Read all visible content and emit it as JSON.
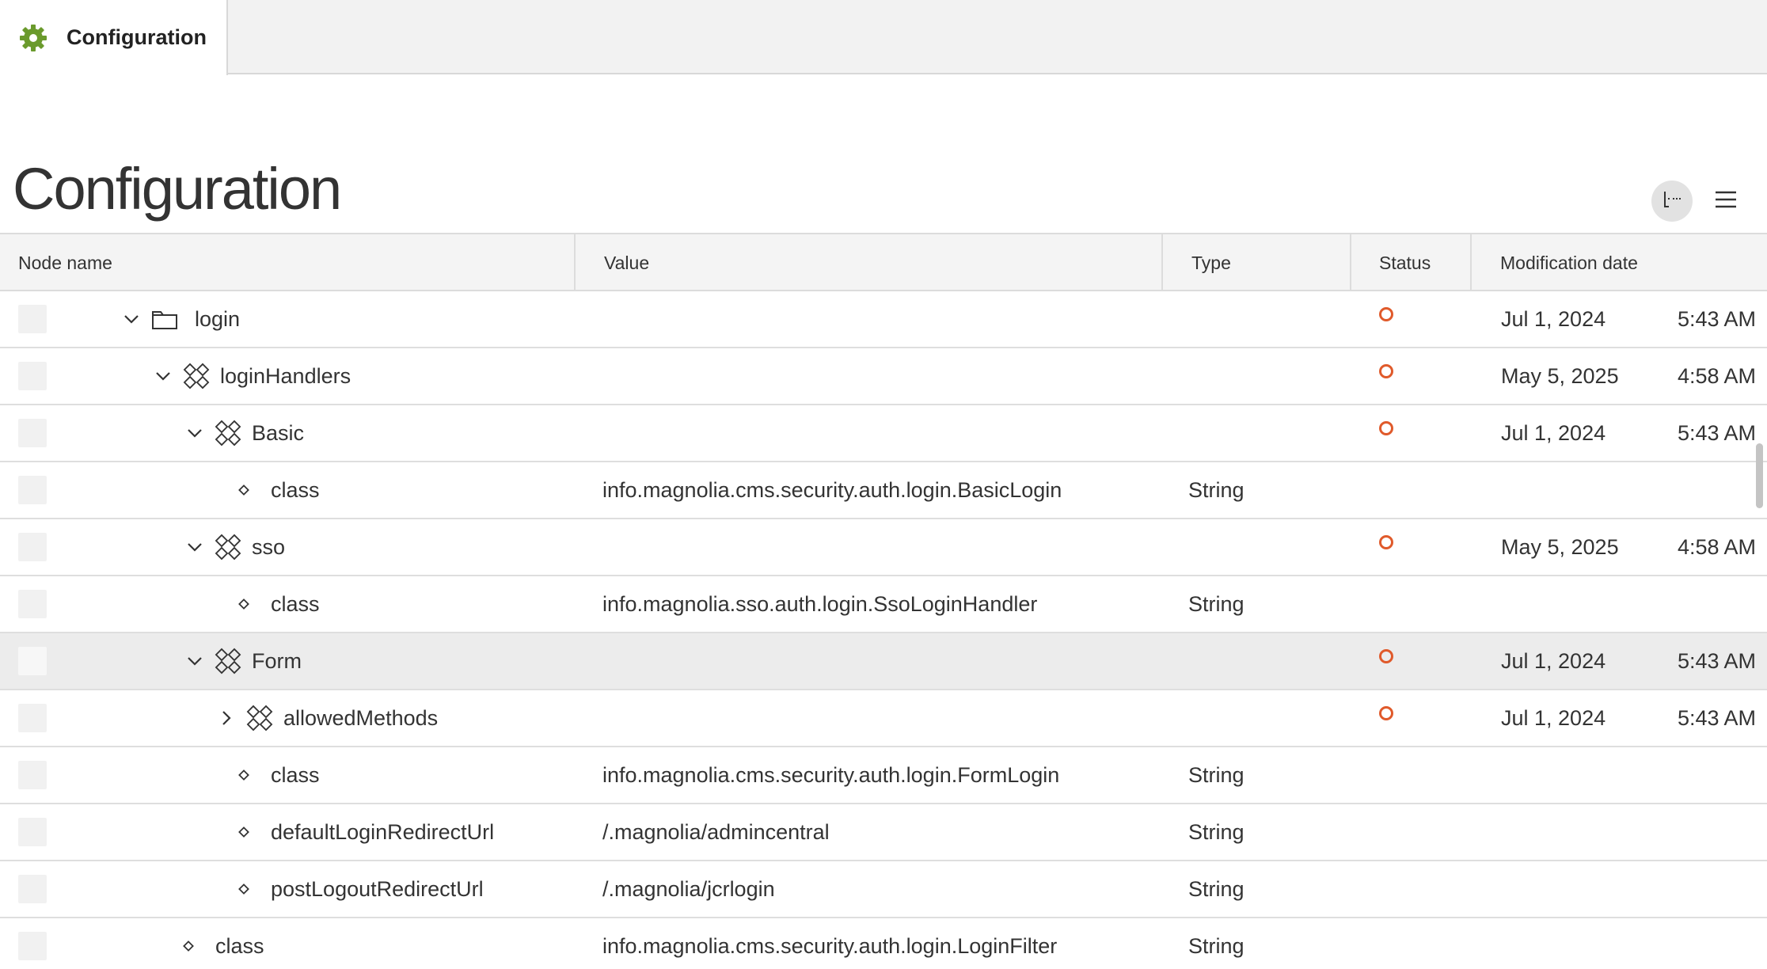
{
  "app": {
    "tab_label": "Configuration",
    "accent_color": "#6a9a2c",
    "page_title": "Configuration"
  },
  "toolbar": {
    "tree_view_icon": "tree-view-icon",
    "list_view_icon": "list-view-icon"
  },
  "grid": {
    "columns": {
      "node_name": "Node name",
      "value": "Value",
      "type": "Type",
      "status": "Status",
      "modification_date": "Modification date"
    },
    "rows": [
      {
        "name": "login",
        "kind": "folder",
        "level": 0,
        "expander": "down",
        "value": "",
        "type": "",
        "status": true,
        "date": "Jul 1, 2024",
        "time": "5:43 AM",
        "selected": false
      },
      {
        "name": "loginHandlers",
        "kind": "content",
        "level": 1,
        "expander": "down",
        "value": "",
        "type": "",
        "status": true,
        "date": "May 5, 2025",
        "time": "4:58 AM",
        "selected": false
      },
      {
        "name": "Basic",
        "kind": "content",
        "level": 2,
        "expander": "down",
        "value": "",
        "type": "",
        "status": true,
        "date": "Jul 1, 2024",
        "time": "5:43 AM",
        "selected": false
      },
      {
        "name": "class",
        "kind": "property",
        "level": 3,
        "expander": "",
        "value": "info.magnolia.cms.security.auth.login.BasicLogin",
        "type": "String",
        "status": false,
        "date": "",
        "time": "",
        "selected": false
      },
      {
        "name": "sso",
        "kind": "content",
        "level": 2,
        "expander": "down",
        "value": "",
        "type": "",
        "status": true,
        "date": "May 5, 2025",
        "time": "4:58 AM",
        "selected": false
      },
      {
        "name": "class",
        "kind": "property",
        "level": 3,
        "expander": "",
        "value": "info.magnolia.sso.auth.login.SsoLoginHandler",
        "type": "String",
        "status": false,
        "date": "",
        "time": "",
        "selected": false
      },
      {
        "name": "Form",
        "kind": "content",
        "level": 2,
        "expander": "down",
        "value": "",
        "type": "",
        "status": true,
        "date": "Jul 1, 2024",
        "time": "5:43 AM",
        "selected": true
      },
      {
        "name": "allowedMethods",
        "kind": "content",
        "level": 3,
        "expander": "right",
        "value": "",
        "type": "",
        "status": true,
        "date": "Jul 1, 2024",
        "time": "5:43 AM",
        "selected": false
      },
      {
        "name": "class",
        "kind": "property",
        "level": 3,
        "expander": "",
        "value": "info.magnolia.cms.security.auth.login.FormLogin",
        "type": "String",
        "status": false,
        "date": "",
        "time": "",
        "selected": false
      },
      {
        "name": "defaultLoginRedirectUrl",
        "kind": "property",
        "level": 3,
        "expander": "",
        "value": "/.magnolia/admincentral",
        "type": "String",
        "status": false,
        "date": "",
        "time": "",
        "selected": false
      },
      {
        "name": "postLogoutRedirectUrl",
        "kind": "property",
        "level": 3,
        "expander": "",
        "value": "/.magnolia/jcrlogin",
        "type": "String",
        "status": false,
        "date": "",
        "time": "",
        "selected": false
      },
      {
        "name": "class",
        "kind": "property",
        "level": 1,
        "expander": "",
        "value": "info.magnolia.cms.security.auth.login.LoginFilter",
        "type": "String",
        "status": false,
        "date": "",
        "time": "",
        "selected": false
      }
    ],
    "status_color": "#e05a2b"
  }
}
